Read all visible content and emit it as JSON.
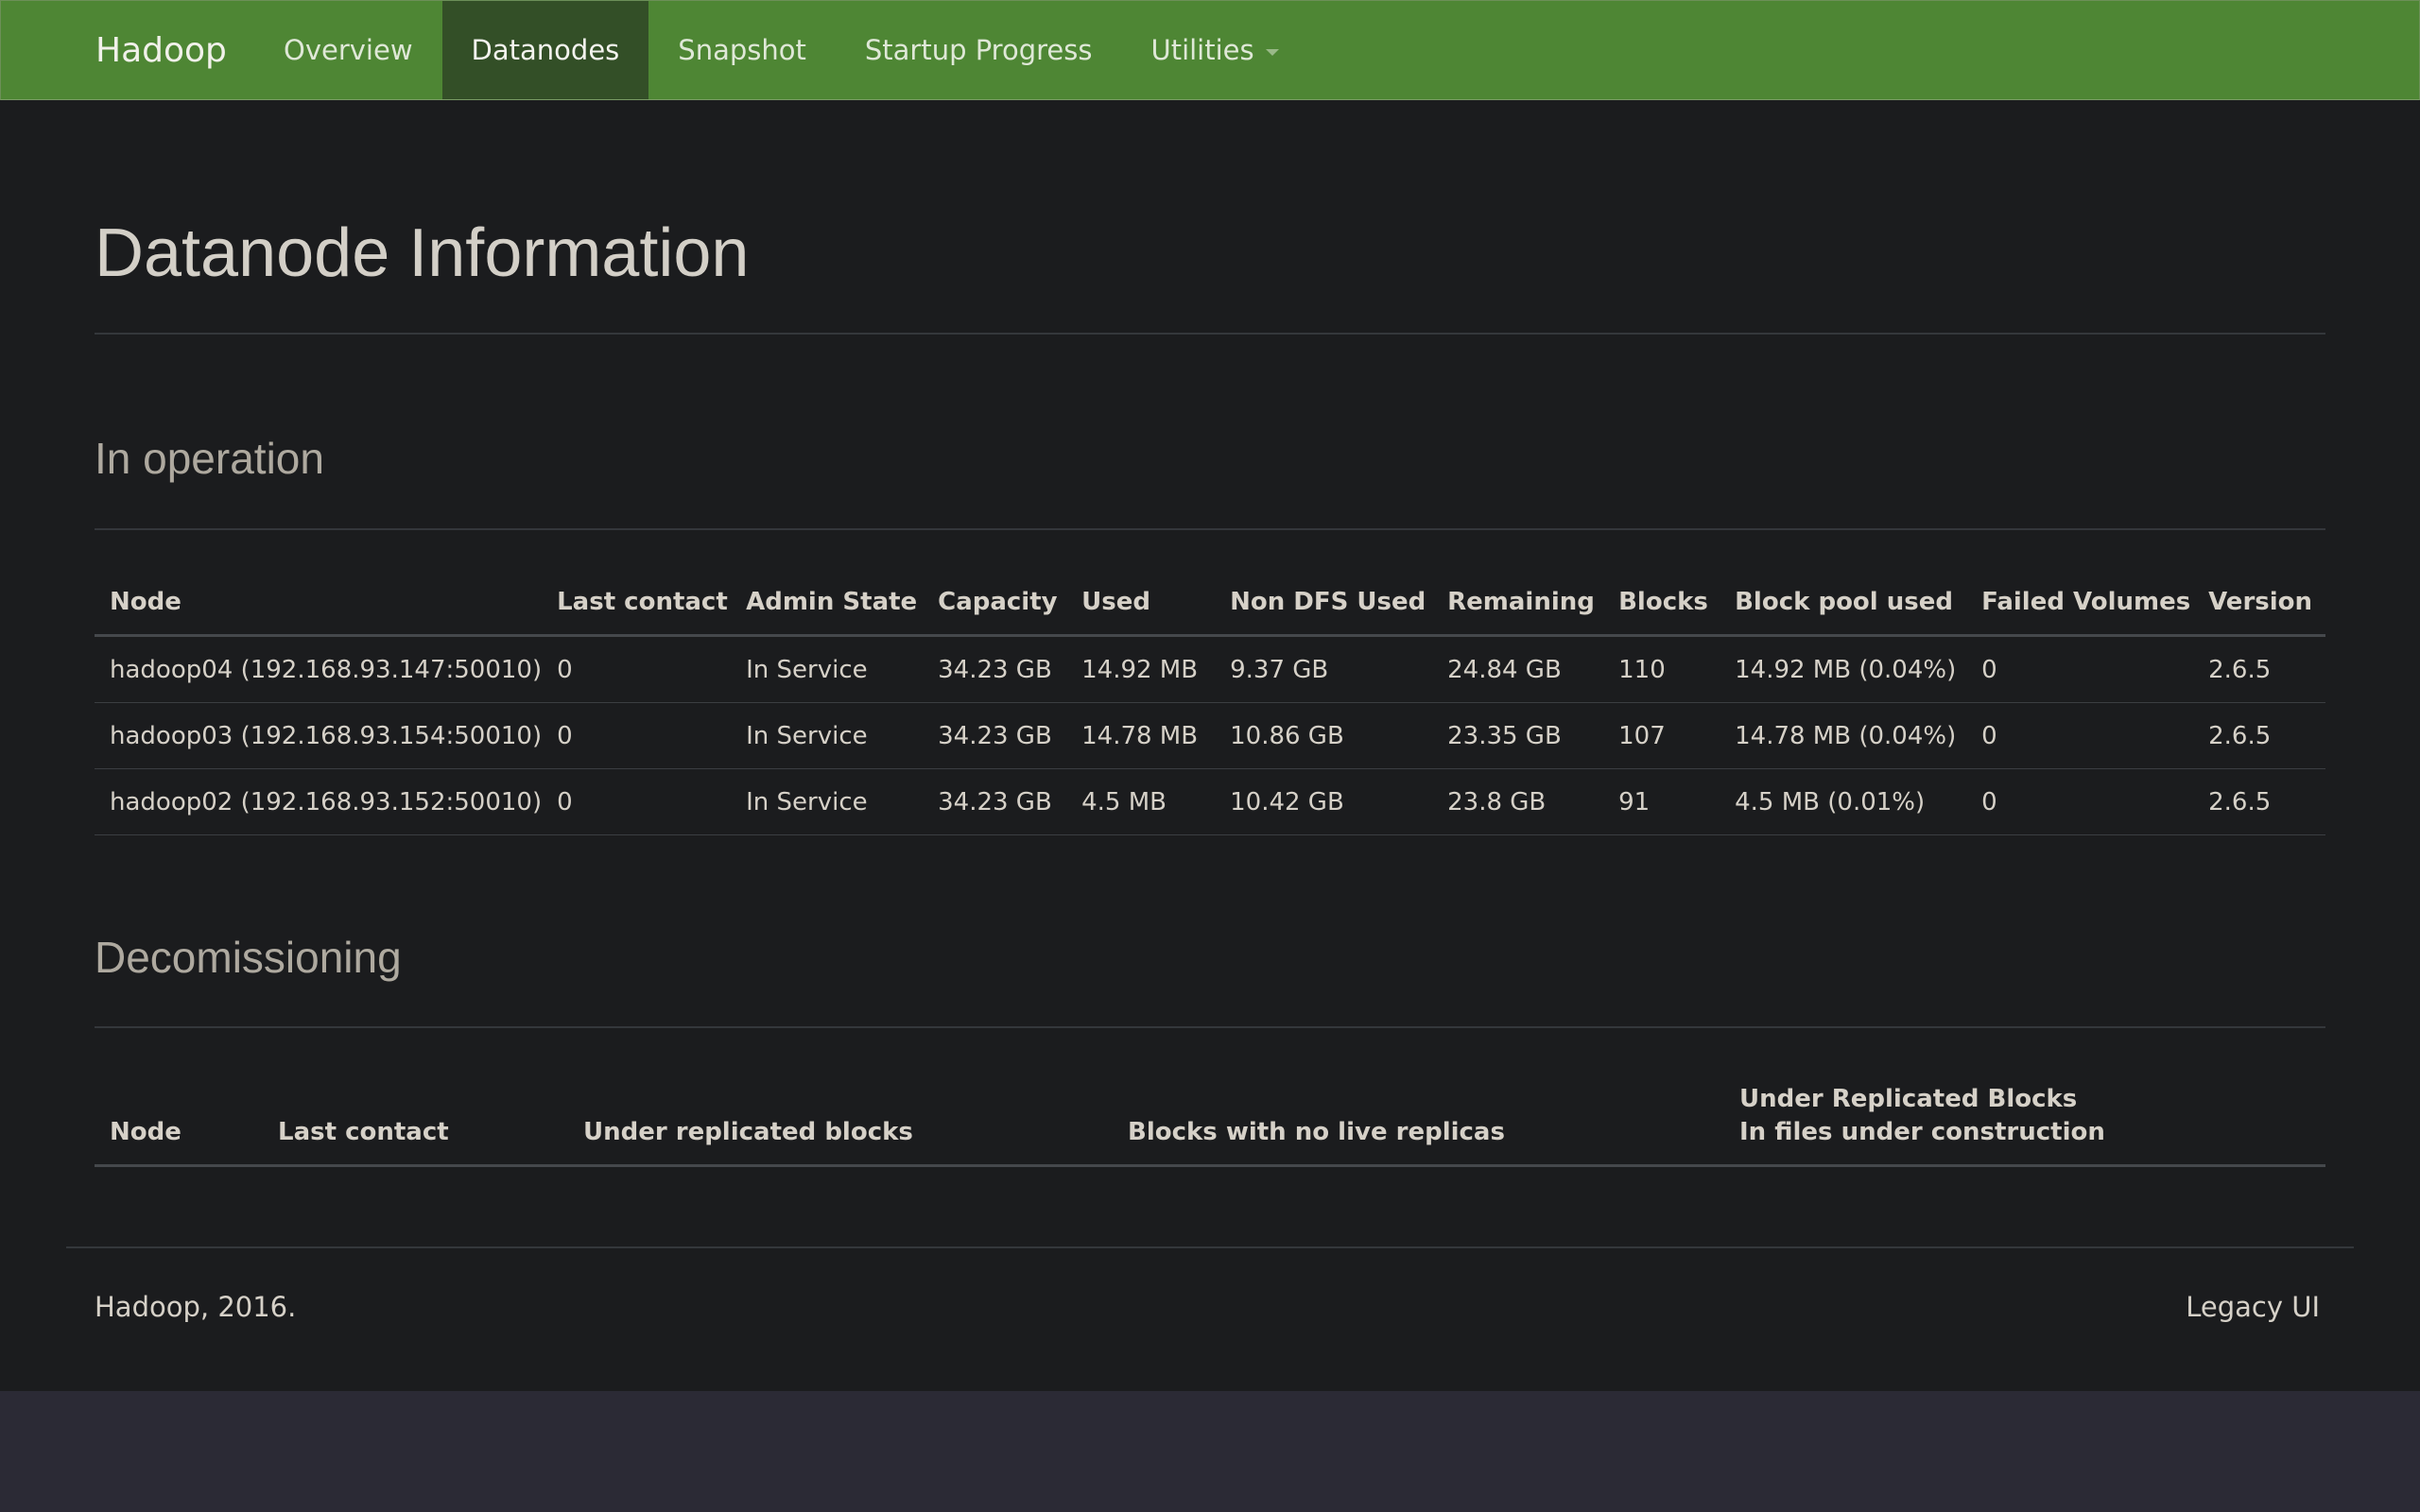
{
  "nav": {
    "brand": "Hadoop",
    "items": [
      {
        "label": "Overview",
        "active": false
      },
      {
        "label": "Datanodes",
        "active": true
      },
      {
        "label": "Snapshot",
        "active": false
      },
      {
        "label": "Startup Progress",
        "active": false
      },
      {
        "label": "Utilities",
        "active": false,
        "dropdown": true
      }
    ]
  },
  "page": {
    "title": "Datanode Information"
  },
  "in_operation": {
    "heading": "In operation",
    "columns": [
      "Node",
      "Last contact",
      "Admin State",
      "Capacity",
      "Used",
      "Non DFS Used",
      "Remaining",
      "Blocks",
      "Block pool used",
      "Failed Volumes",
      "Version"
    ],
    "rows": [
      [
        "hadoop04 (192.168.93.147:50010)",
        "0",
        "In Service",
        "34.23 GB",
        "14.92 MB",
        "9.37 GB",
        "24.84 GB",
        "110",
        "14.92 MB (0.04%)",
        "0",
        "2.6.5"
      ],
      [
        "hadoop03 (192.168.93.154:50010)",
        "0",
        "In Service",
        "34.23 GB",
        "14.78 MB",
        "10.86 GB",
        "23.35 GB",
        "107",
        "14.78 MB (0.04%)",
        "0",
        "2.6.5"
      ],
      [
        "hadoop02 (192.168.93.152:50010)",
        "0",
        "In Service",
        "34.23 GB",
        "4.5 MB",
        "10.42 GB",
        "23.8 GB",
        "91",
        "4.5 MB (0.01%)",
        "0",
        "2.6.5"
      ]
    ]
  },
  "decommissioning": {
    "heading": "Decomissioning",
    "columns": [
      "Node",
      "Last contact",
      "Under replicated blocks",
      "Blocks with no live replicas"
    ],
    "last_column": {
      "line1": "Under Replicated Blocks",
      "line2": "In files under construction"
    }
  },
  "footer": {
    "copyright": "Hadoop, 2016.",
    "legacy_link": "Legacy UI"
  },
  "colors": {
    "navbar": "#4e8634",
    "navbar_active": "#334f27",
    "page_bg": "#1b1c1e",
    "outer_bg": "#2b2a35"
  }
}
